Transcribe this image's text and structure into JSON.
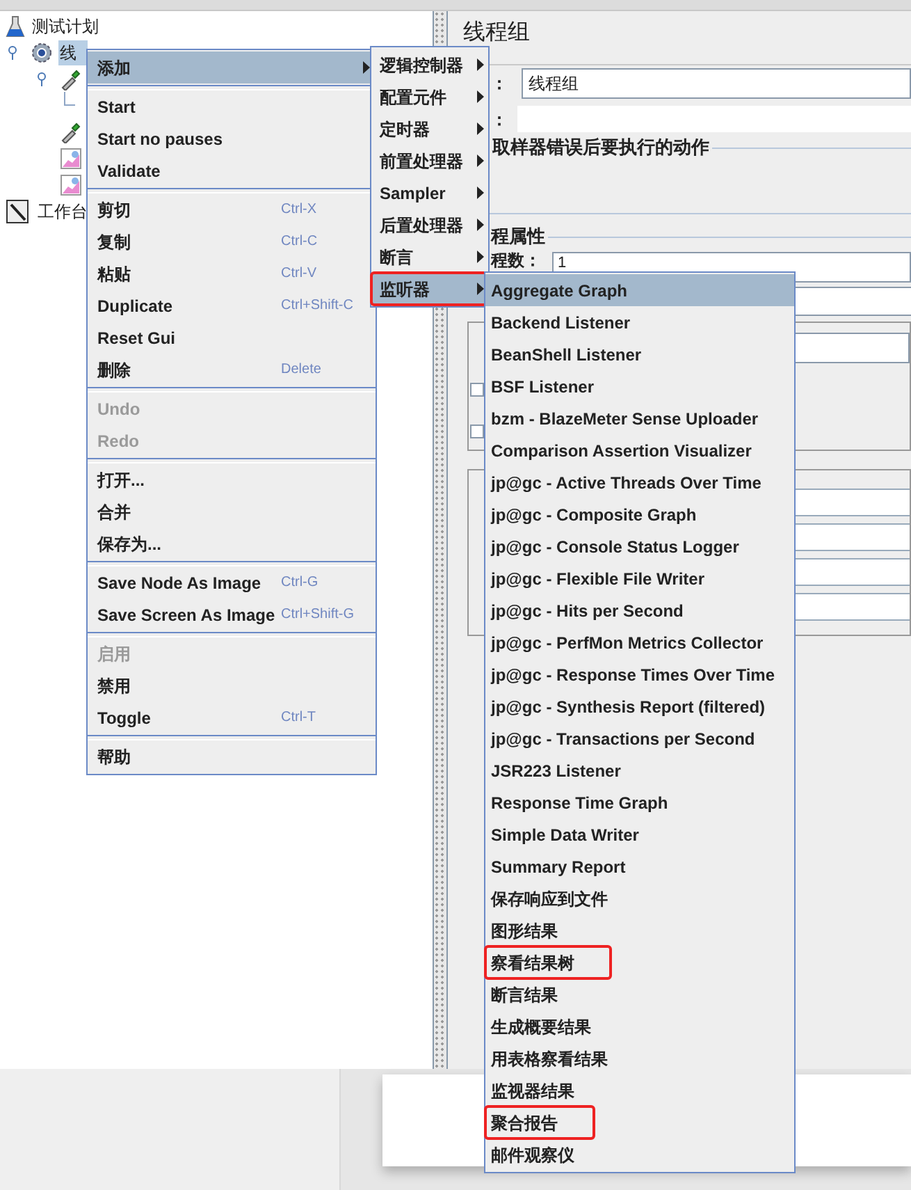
{
  "tree": [
    {
      "label": "测试计划",
      "kind": "plan",
      "children": [
        {
          "label": "线",
          "kind": "thread-group",
          "selected": true,
          "expanded": true,
          "children": [
            {
              "kind": "sampler",
              "expanded": true,
              "children": [
                {
                  "kind": "hidden"
                }
              ]
            },
            {
              "kind": "sampler"
            },
            {
              "kind": "listener"
            },
            {
              "kind": "listener"
            }
          ]
        }
      ]
    },
    {
      "label": "工作台",
      "kind": "workbench"
    }
  ],
  "editor": {
    "title": "线程组",
    "name_label": "：",
    "name_value": "线程组",
    "comment_label": "：",
    "error_group": "取样器错误后要执行的动作",
    "props_group": "程属性",
    "threads_label": "程数：",
    "threads_value": "1",
    "checkboxes": [
      {
        "checked": false
      },
      {
        "checked": false
      }
    ]
  },
  "context_menu": [
    {
      "kind": "item",
      "label": "添加",
      "arrow": true,
      "selected": true,
      "disabled": false
    },
    {
      "kind": "separator"
    },
    {
      "kind": "item",
      "label": "Start",
      "arrow": false,
      "selected": false,
      "disabled": false
    },
    {
      "kind": "item",
      "label": "Start no pauses",
      "arrow": false,
      "selected": false,
      "disabled": false
    },
    {
      "kind": "item",
      "label": "Validate",
      "arrow": false,
      "selected": false,
      "disabled": false
    },
    {
      "kind": "separator"
    },
    {
      "kind": "item",
      "label": "剪切",
      "shortcut": "Ctrl-X",
      "arrow": false,
      "selected": false,
      "disabled": false
    },
    {
      "kind": "item",
      "label": "复制",
      "shortcut": "Ctrl-C",
      "arrow": false,
      "selected": false,
      "disabled": false
    },
    {
      "kind": "item",
      "label": "粘贴",
      "shortcut": "Ctrl-V",
      "arrow": false,
      "selected": false,
      "disabled": false
    },
    {
      "kind": "item",
      "label": "Duplicate",
      "shortcut": "Ctrl+Shift-C",
      "arrow": false,
      "selected": false,
      "disabled": false
    },
    {
      "kind": "item",
      "label": "Reset Gui",
      "arrow": false,
      "selected": false,
      "disabled": false
    },
    {
      "kind": "item",
      "label": "删除",
      "shortcut": "Delete",
      "arrow": false,
      "selected": false,
      "disabled": false
    },
    {
      "kind": "separator"
    },
    {
      "kind": "item",
      "label": "Undo",
      "arrow": false,
      "selected": false,
      "disabled": true
    },
    {
      "kind": "item",
      "label": "Redo",
      "arrow": false,
      "selected": false,
      "disabled": true
    },
    {
      "kind": "separator"
    },
    {
      "kind": "item",
      "label": "打开...",
      "arrow": false,
      "selected": false,
      "disabled": false
    },
    {
      "kind": "item",
      "label": "合并",
      "arrow": false,
      "selected": false,
      "disabled": false
    },
    {
      "kind": "item",
      "label": "保存为...",
      "arrow": false,
      "selected": false,
      "disabled": false
    },
    {
      "kind": "separator"
    },
    {
      "kind": "item",
      "label": "Save Node As Image",
      "shortcut": "Ctrl-G",
      "arrow": false,
      "selected": false,
      "disabled": false
    },
    {
      "kind": "item",
      "label": "Save Screen As Image",
      "shortcut": "Ctrl+Shift-G",
      "arrow": false,
      "selected": false,
      "disabled": false
    },
    {
      "kind": "separator"
    },
    {
      "kind": "item",
      "label": "启用",
      "arrow": false,
      "selected": false,
      "disabled": true
    },
    {
      "kind": "item",
      "label": "禁用",
      "arrow": false,
      "selected": false,
      "disabled": false
    },
    {
      "kind": "item",
      "label": "Toggle",
      "shortcut": "Ctrl-T",
      "arrow": false,
      "selected": false,
      "disabled": false
    },
    {
      "kind": "separator"
    },
    {
      "kind": "item",
      "label": "帮助",
      "arrow": false,
      "selected": false,
      "disabled": false
    }
  ],
  "add_submenu": [
    {
      "label": "逻辑控制器",
      "selected": false,
      "annotated": false
    },
    {
      "label": "配置元件",
      "selected": false,
      "annotated": false
    },
    {
      "label": "定时器",
      "selected": false,
      "annotated": false
    },
    {
      "label": "前置处理器",
      "selected": false,
      "annotated": false
    },
    {
      "label": "Sampler",
      "selected": false,
      "annotated": false
    },
    {
      "label": "后置处理器",
      "selected": false,
      "annotated": false
    },
    {
      "label": "断言",
      "selected": false,
      "annotated": false
    },
    {
      "label": "监听器",
      "selected": true,
      "annotated": true
    }
  ],
  "listener_submenu": [
    {
      "label": "Aggregate Graph",
      "selected": true,
      "annotated": false
    },
    {
      "label": "Backend Listener",
      "selected": false,
      "annotated": false
    },
    {
      "label": "BeanShell Listener",
      "selected": false,
      "annotated": false
    },
    {
      "label": "BSF Listener",
      "selected": false,
      "annotated": false
    },
    {
      "label": "bzm - BlazeMeter Sense Uploader",
      "selected": false,
      "annotated": false
    },
    {
      "label": "Comparison Assertion Visualizer",
      "selected": false,
      "annotated": false
    },
    {
      "label": "jp@gc - Active Threads Over Time",
      "selected": false,
      "annotated": false
    },
    {
      "label": "jp@gc - Composite Graph",
      "selected": false,
      "annotated": false
    },
    {
      "label": "jp@gc - Console Status Logger",
      "selected": false,
      "annotated": false
    },
    {
      "label": "jp@gc - Flexible File Writer",
      "selected": false,
      "annotated": false
    },
    {
      "label": "jp@gc - Hits per Second",
      "selected": false,
      "annotated": false
    },
    {
      "label": "jp@gc - PerfMon Metrics Collector",
      "selected": false,
      "annotated": false
    },
    {
      "label": "jp@gc - Response Times Over Time",
      "selected": false,
      "annotated": false
    },
    {
      "label": "jp@gc - Synthesis Report (filtered)",
      "selected": false,
      "annotated": false
    },
    {
      "label": "jp@gc - Transactions per Second",
      "selected": false,
      "annotated": false
    },
    {
      "label": "JSR223 Listener",
      "selected": false,
      "annotated": false
    },
    {
      "label": "Response Time Graph",
      "selected": false,
      "annotated": false
    },
    {
      "label": "Simple Data Writer",
      "selected": false,
      "annotated": false
    },
    {
      "label": "Summary Report",
      "selected": false,
      "annotated": false
    },
    {
      "label": "保存响应到文件",
      "selected": false,
      "annotated": false
    },
    {
      "label": "图形结果",
      "selected": false,
      "annotated": false
    },
    {
      "label": "察看结果树",
      "selected": false,
      "annotated": true
    },
    {
      "label": "断言结果",
      "selected": false,
      "annotated": false
    },
    {
      "label": "生成概要结果",
      "selected": false,
      "annotated": false
    },
    {
      "label": "用表格察看结果",
      "selected": false,
      "annotated": false
    },
    {
      "label": "监视器结果",
      "selected": false,
      "annotated": false
    },
    {
      "label": "聚合报告",
      "selected": false,
      "annotated": true
    },
    {
      "label": "邮件观察仪",
      "selected": false,
      "annotated": false
    }
  ]
}
